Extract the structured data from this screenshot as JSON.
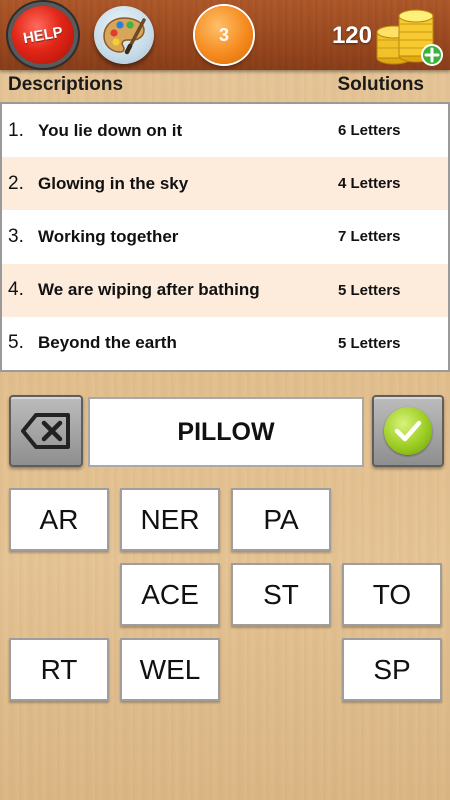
{
  "header": {
    "help_label": "HELP",
    "level": "3",
    "coins": "120",
    "colors": {
      "bar": "#9c4a20",
      "help": "#e22718",
      "level": "#f58b1e",
      "coin": "#f2c22a",
      "plus": "#3cb23c"
    }
  },
  "columns": {
    "descriptions": "Descriptions",
    "solutions": "Solutions"
  },
  "clues": [
    {
      "num": "1.",
      "text": "You lie down on it",
      "solution": "6 Letters"
    },
    {
      "num": "2.",
      "text": "Glowing in the sky",
      "solution": "4 Letters"
    },
    {
      "num": "3.",
      "text": "Working together",
      "solution": "7 Letters"
    },
    {
      "num": "4.",
      "text": "We are wiping after bathing",
      "solution": "5 Letters"
    },
    {
      "num": "5.",
      "text": "Beyond the earth",
      "solution": "5 Letters"
    }
  ],
  "answer": {
    "value": "PILLOW"
  },
  "tiles": [
    {
      "label": "AR"
    },
    {
      "label": "NER"
    },
    {
      "label": "PA"
    },
    {
      "label": "ACE"
    },
    {
      "label": "ST"
    },
    {
      "label": "TO"
    },
    {
      "label": "RT"
    },
    {
      "label": "WEL"
    },
    {
      "label": "SP"
    }
  ]
}
